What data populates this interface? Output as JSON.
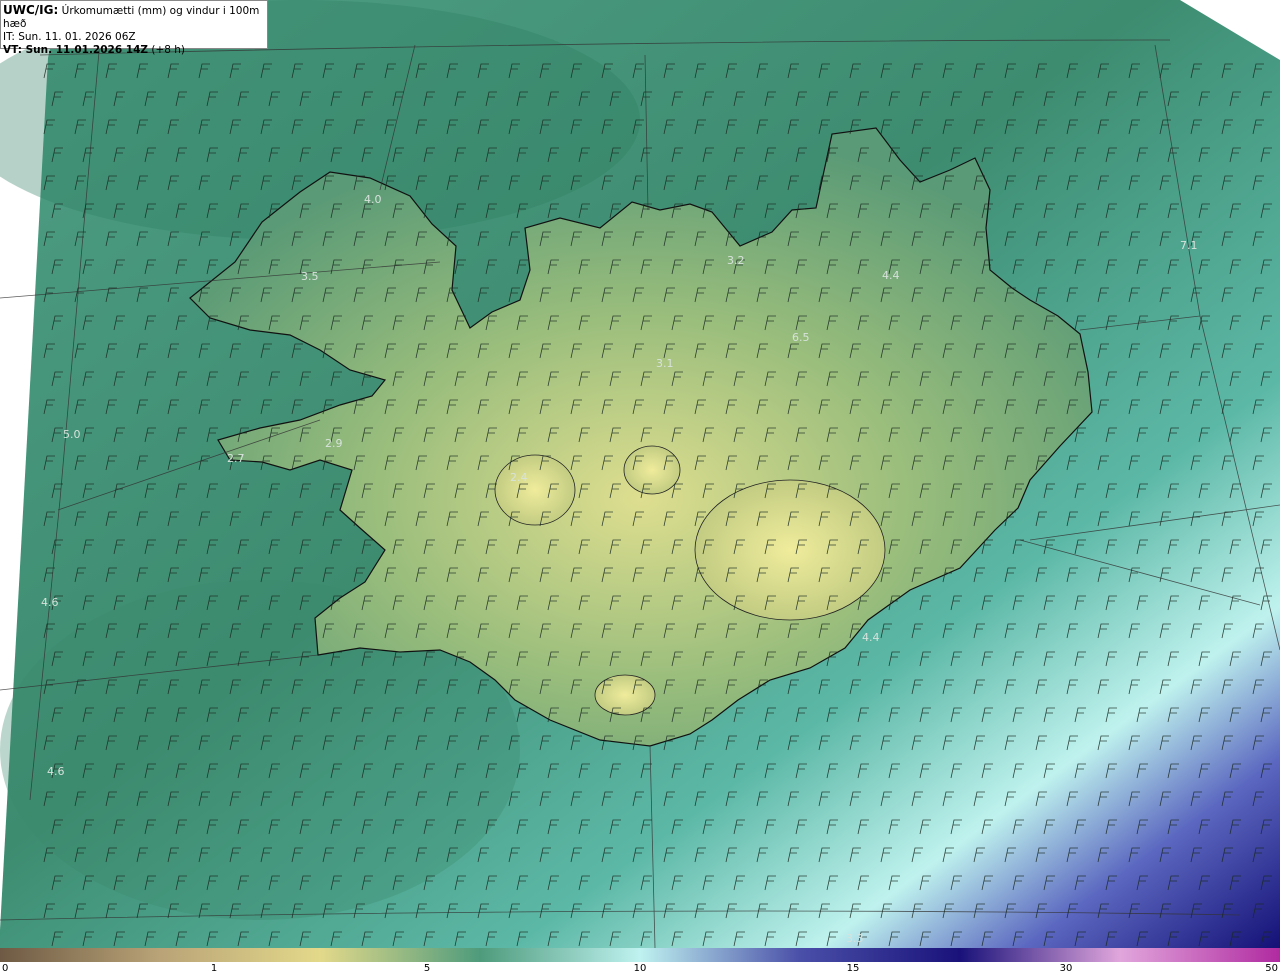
{
  "header": {
    "title_bold": "UWC/IG:",
    "title_rest": " Úrkomumætti (mm) og vindur i 100m hæð",
    "it_line": "IT: Sun. 11. 01. 2026 06Z",
    "vt_bold": "VT: Sun. 11.01.2026 14Z",
    "vt_rest": " (+8 h)"
  },
  "map_values": [
    "4.0",
    "3.5",
    "3.2",
    "4.4",
    "6.5",
    "3.1",
    "5.0",
    "2.9",
    "2.7",
    "2.4",
    "4.6",
    "4.6",
    "4.4",
    "7.1",
    "3.3"
  ],
  "colorbar": {
    "ticks": [
      "0",
      "1",
      "5",
      "10",
      "15",
      "30",
      "50"
    ],
    "colors": [
      "#6e5a44",
      "#b9a377",
      "#e3d98a",
      "#4e9b7c",
      "#bff2f0",
      "#4a4fa8",
      "#19127a",
      "#e1a6dc",
      "#b02aa0"
    ]
  }
}
